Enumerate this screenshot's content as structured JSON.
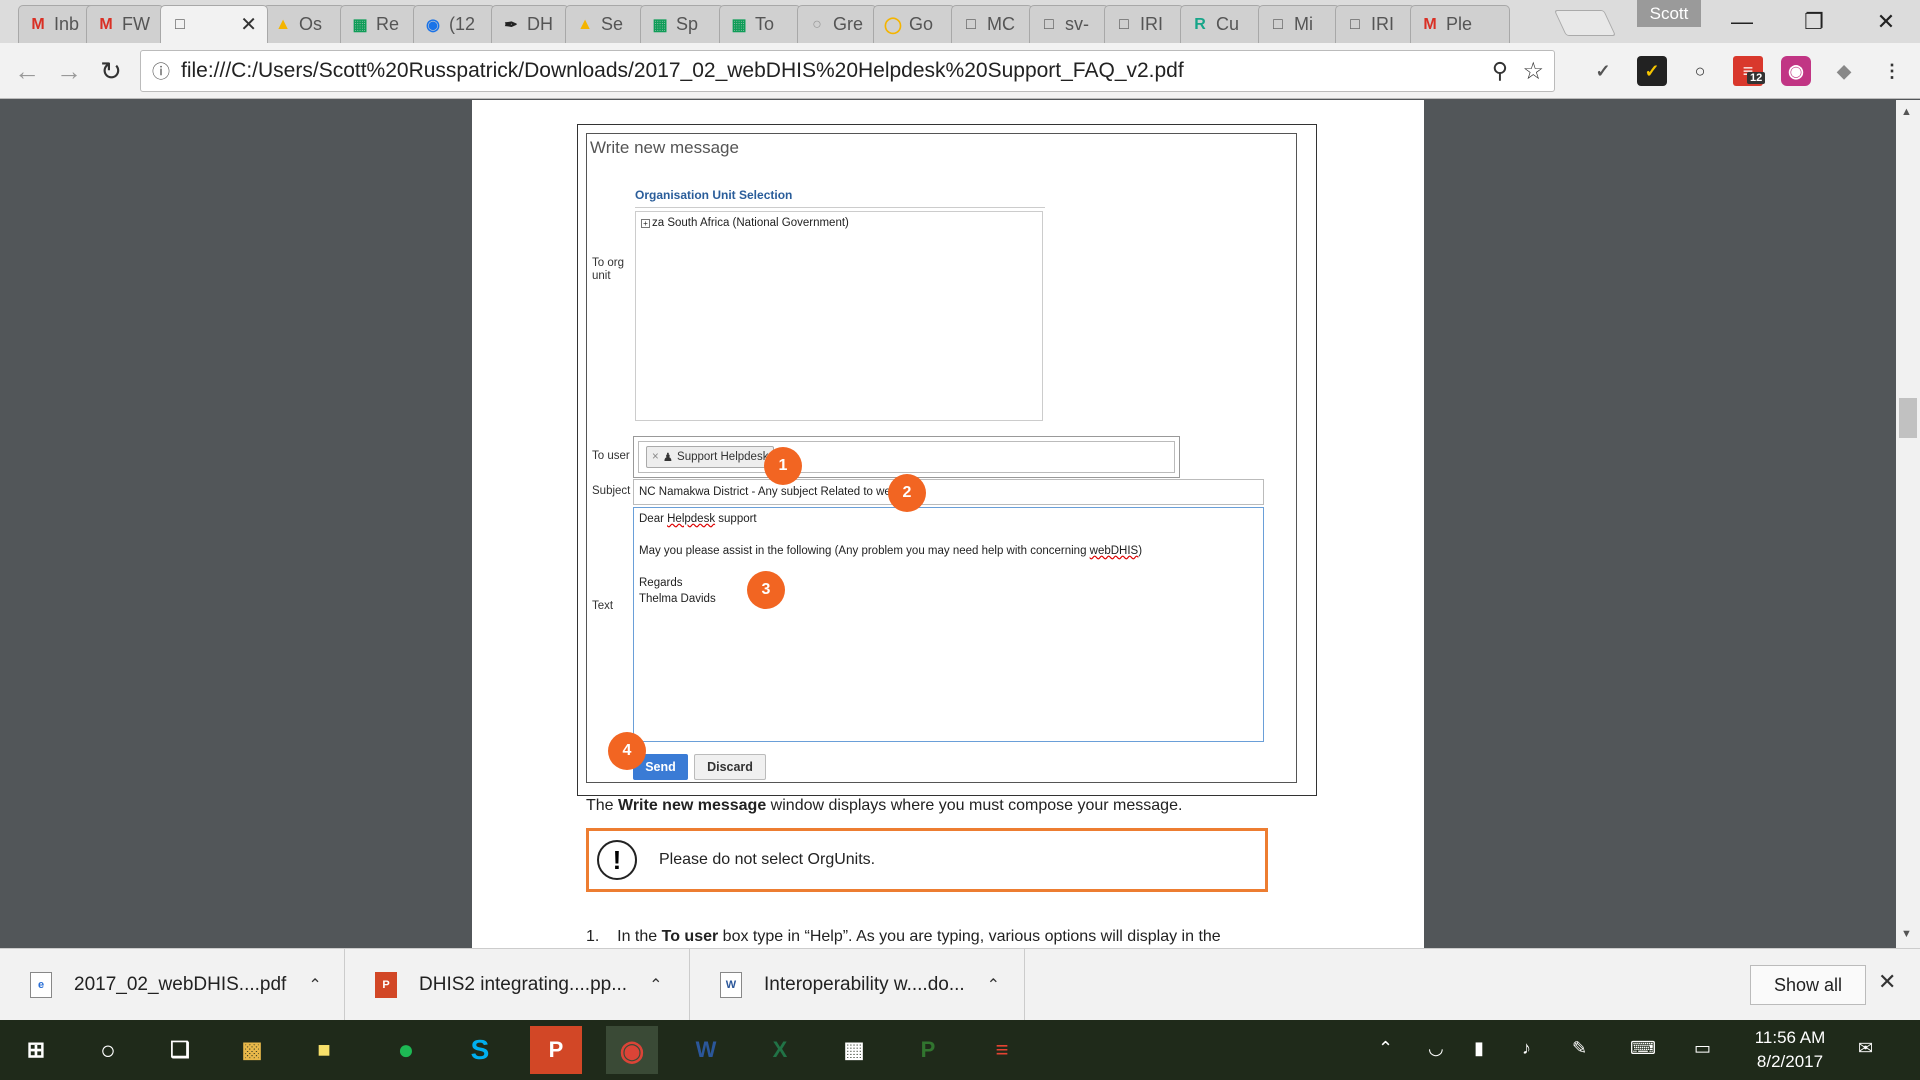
{
  "browser": {
    "profile_name": "Scott",
    "tabs": [
      {
        "icon": "gmail-icon",
        "label": "Inb"
      },
      {
        "icon": "gmail-icon",
        "label": "FW"
      },
      {
        "icon": "document-icon",
        "label": "",
        "active": true
      },
      {
        "icon": "drive-icon",
        "label": "Os"
      },
      {
        "icon": "sheets-icon",
        "label": "Re"
      },
      {
        "icon": "globe-icon",
        "label": "(12"
      },
      {
        "icon": "feather-icon",
        "label": "DH"
      },
      {
        "icon": "drive-icon",
        "label": "Se"
      },
      {
        "icon": "sheets-icon",
        "label": "Sp"
      },
      {
        "icon": "sheets-icon",
        "label": "To"
      },
      {
        "icon": "lemon-icon",
        "label": "Gre"
      },
      {
        "icon": "bulb-icon",
        "label": "Go"
      },
      {
        "icon": "document-icon",
        "label": "MC"
      },
      {
        "icon": "document-icon",
        "label": "sv-"
      },
      {
        "icon": "document-icon",
        "label": "IRI"
      },
      {
        "icon": "r-icon",
        "label": "Cu"
      },
      {
        "icon": "document-icon",
        "label": "Mi"
      },
      {
        "icon": "document-icon",
        "label": "IRI"
      },
      {
        "icon": "gmail-icon",
        "label": "Ple"
      }
    ],
    "address": "file:///C:/Users/Scott%20Russpatrick/Downloads/2017_02_webDHIS%20Helpdesk%20Support_FAQ_v2.pdf",
    "extension_badge": "12"
  },
  "form": {
    "window_title": "Write new message",
    "org_section_title": "Organisation Unit Selection",
    "org_root": "za South Africa (National Government)",
    "label_to_org": "To org unit",
    "label_to_user": "To user",
    "recipient_chip": "Support Helpdesk",
    "label_subject": "Subject",
    "subject_value": "NC Namakwa District - Any subject Related to webDHIS",
    "label_text": "Text",
    "body_line1_pre": "Dear ",
    "body_line1_word": "Helpdesk",
    "body_line1_post": " support",
    "body_line2_pre": "May you please assist in the following (Any problem you may need help with concerning ",
    "body_line2_word": "webDHIS",
    "body_line2_post": ")",
    "body_line3": "Regards",
    "body_line4": "Thelma Davids",
    "send_label": "Send",
    "discard_label": "Discard",
    "markers": [
      "1",
      "2",
      "3",
      "4"
    ]
  },
  "document": {
    "para_pre": "The ",
    "para_bold": "Write new message",
    "para_post": " window displays where you must compose your message.",
    "warning_text": "Please do not select OrgUnits.",
    "step_num": "1.",
    "step_pre": "In the ",
    "step_bold": "To user",
    "step_post": " box type in “Help”. As you are typing, various options will display in the"
  },
  "downloads": {
    "items": [
      {
        "name": "2017_02_webDHIS....pdf",
        "icon": "pdf-icon"
      },
      {
        "name": "DHIS2 integrating....pp...",
        "icon": "powerpoint-icon"
      },
      {
        "name": "Interoperability w....do...",
        "icon": "word-icon"
      }
    ],
    "show_all": "Show all"
  },
  "taskbar": {
    "time": "11:56 AM",
    "date": "8/2/2017"
  },
  "colors": {
    "accent_orange": "#f26522",
    "warning_border": "#ed7d31",
    "send_blue": "#3a7bd5",
    "section_blue": "#2a5d9a"
  }
}
